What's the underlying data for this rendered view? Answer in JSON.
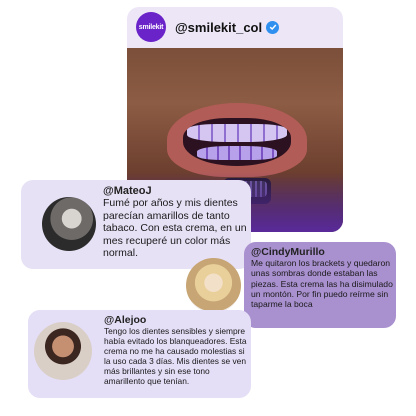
{
  "post": {
    "brand_logo_text": "smilekit",
    "handle": "@smilekit_col",
    "verified": true,
    "accent_color": "#6a22c9"
  },
  "reviews": [
    {
      "author": "@MateoJ",
      "text": "Fumé por años y mis dientes parecían amarillos de tanto tabaco. Con esta crema, en un mes recuperé un color más normal."
    },
    {
      "author": "@CindyMurillo",
      "text": "Me quitaron los brackets y quedaron unas sombras donde estaban las piezas. Esta crema las ha disimulado un montón. Por fin puedo reírme sin taparme la boca"
    },
    {
      "author": "@Alejoo",
      "text": "Tengo los dientes sensibles y siempre había evitado los blanqueadores. Esta crema no me ha causado molestias si la uso cada 3 días. Mis dientes se ven más brillantes y sin ese tono amarillento que tenían."
    }
  ]
}
